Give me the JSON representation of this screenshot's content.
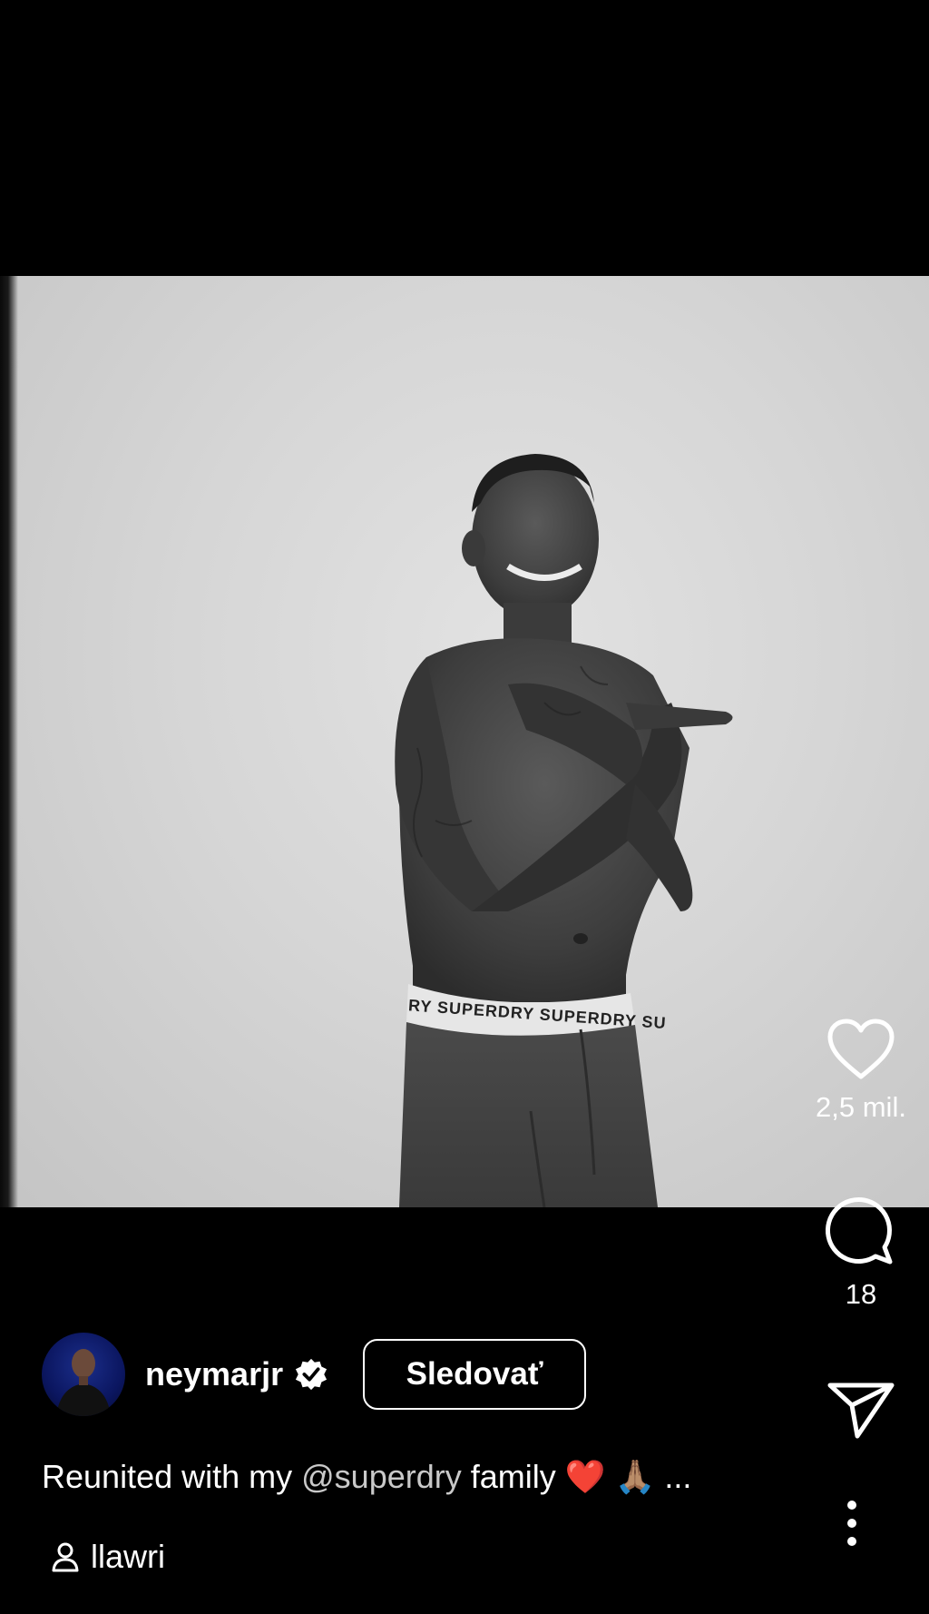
{
  "post": {
    "username": "neymarjr",
    "follow_label": "Sledovať",
    "caption_before": "Reunited with my ",
    "caption_mention": "@superdry",
    "caption_after": " family ❤️ 🙏🏽 ...",
    "audio_label": "llawri",
    "waistband_text": "RY  SUPERDRY   SUPERDRY  SU"
  },
  "actions": {
    "likes": "2,5 mil.",
    "comments": "18"
  },
  "icons": {
    "like": "heart-icon",
    "comment": "comment-bubble-icon",
    "share": "send-icon",
    "more": "more-vertical-icon",
    "verified": "verified-badge-icon",
    "audio": "person-icon"
  },
  "colors": {
    "background": "#000000",
    "text": "#ffffff",
    "mention": "#c9c9c9"
  }
}
